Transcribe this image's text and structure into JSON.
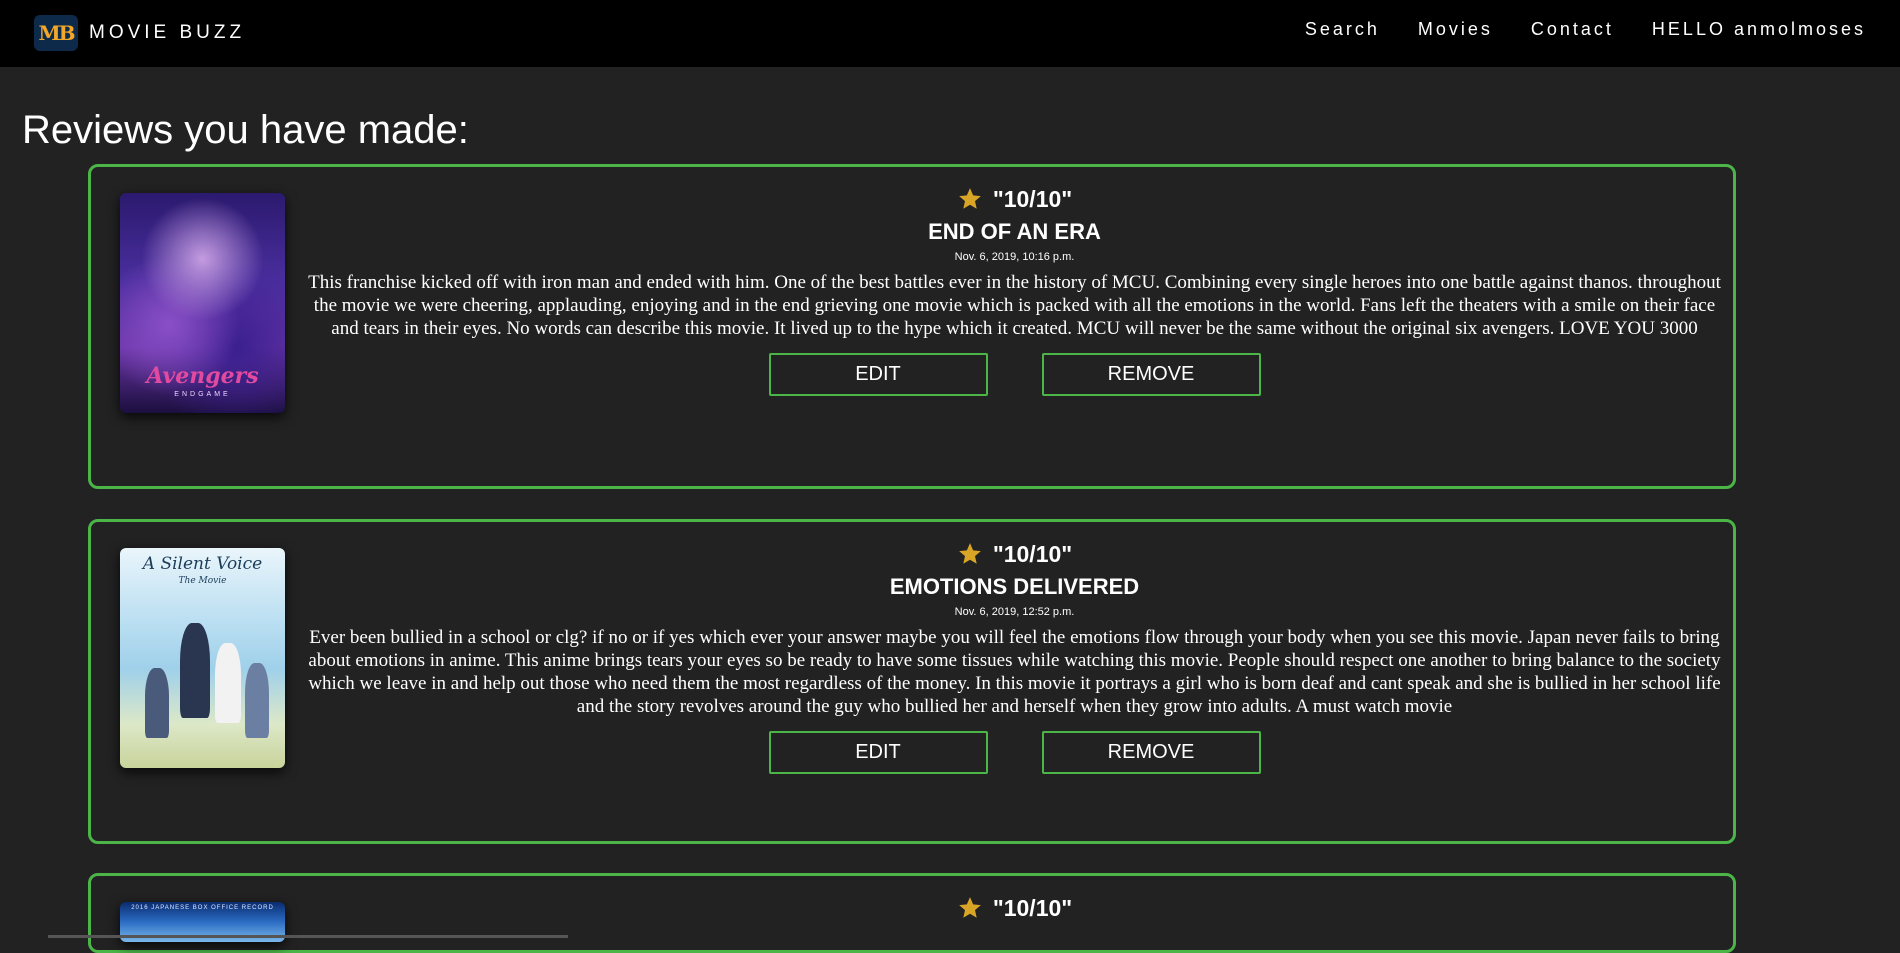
{
  "nav": {
    "logo_text": "MB",
    "brand": "MOVIE BUZZ",
    "links": [
      "Search",
      "Movies",
      "Contact"
    ],
    "greeting": "HELLO anmolmoses"
  },
  "page": {
    "heading": "Reviews you have made:"
  },
  "colors": {
    "background": "#222222",
    "navbar": "#000000",
    "card_border": "#4bb548",
    "star": "#d9a526"
  },
  "reviews": [
    {
      "poster_icon": "avengers-endgame-poster",
      "poster_title": "Avengers",
      "poster_subtitle": "ENDGAME",
      "rating": "\"10/10\"",
      "title": "END OF AN ERA",
      "date": "Nov. 6, 2019, 10:16 p.m.",
      "text": "This franchise kicked off with iron man and ended with him. One of the best battles ever in the history of MCU. Combining every single heroes into one battle against thanos. throughout the movie we were cheering, applauding, enjoying and in the end grieving one movie which is packed with all the emotions in the world. Fans left the theaters with a smile on their face and tears in their eyes. No words can describe this movie. It lived up to the hype which it created. MCU will never be the same without the original six avengers. LOVE YOU 3000",
      "edit_label": "EDIT",
      "remove_label": "REMOVE"
    },
    {
      "poster_icon": "a-silent-voice-poster",
      "poster_title": "A Silent Voice",
      "poster_subtitle": "The Movie",
      "rating": "\"10/10\"",
      "title": "EMOTIONS DELIVERED",
      "date": "Nov. 6, 2019, 12:52 p.m.",
      "text": "Ever been bullied in a school or clg? if no or if yes which ever your answer maybe you will feel the emotions flow through your body when you see this movie. Japan never fails to bring about emotions in anime. This anime brings tears your eyes so be ready to have some tissues while watching this movie. People should respect one another to bring balance to the society which we leave in and help out those who need them the most regardless of the money. In this movie it portrays a girl who is born deaf and cant speak and she is bullied in her school life and the story revolves around the guy who bullied her and herself when they grow into adults. A must watch movie",
      "edit_label": "EDIT",
      "remove_label": "REMOVE"
    },
    {
      "poster_icon": "movie-poster",
      "poster_title": "2016 JAPANESE BOX OFFICE RECORD",
      "rating": "\"10/10\""
    }
  ]
}
